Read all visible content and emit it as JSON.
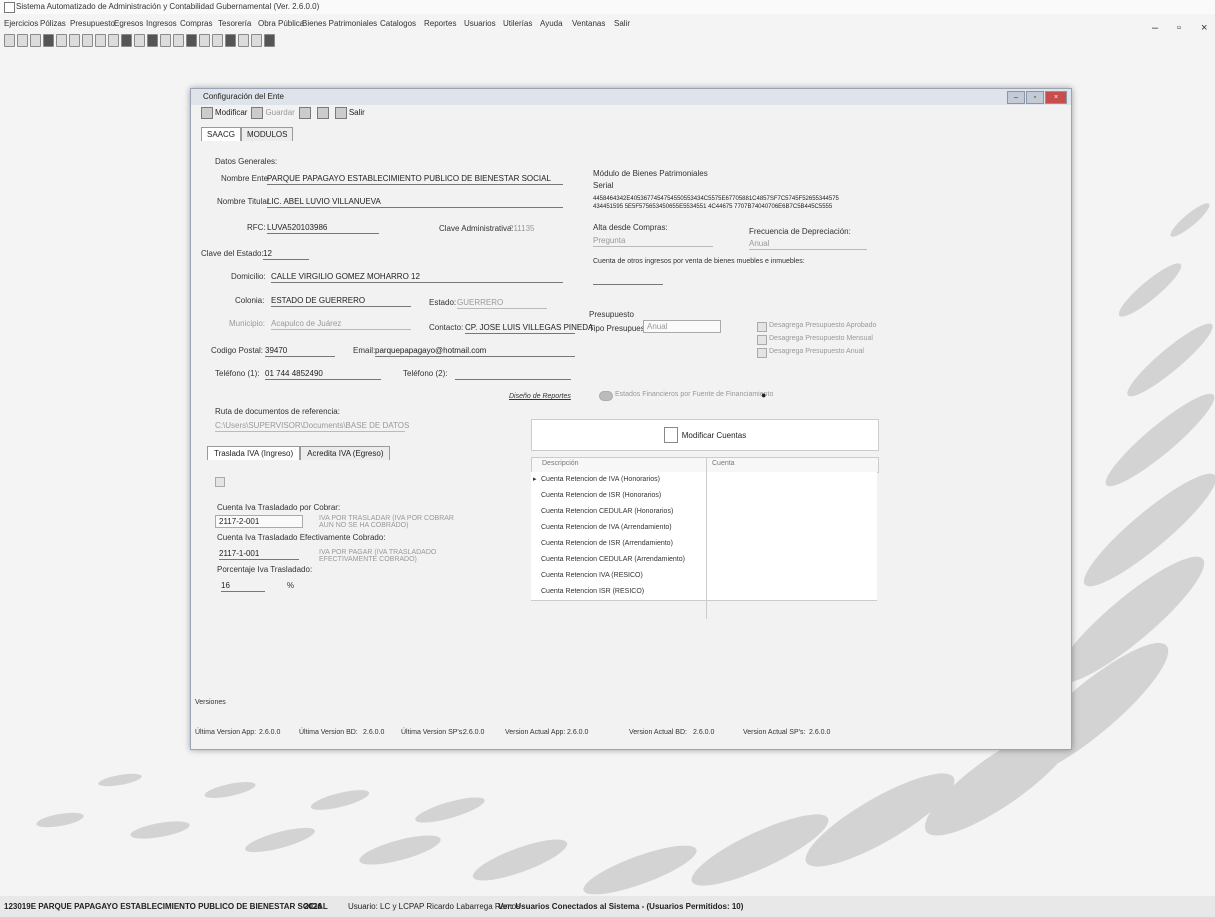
{
  "app": {
    "title": "Sistema Automatizado de Administración y Contabilidad Gubernamental (Ver. 2.6.0.0)"
  },
  "window_controls": {
    "minimize": "–",
    "restore": "▫",
    "close": "×"
  },
  "menu": [
    "Ejercicios",
    "Pólizas",
    "Presupuesto",
    "Egresos",
    "Ingresos",
    "Compras",
    "Tesorería",
    "Obra Pública",
    "Bienes Patrimoniales",
    "Catalogos",
    "Reportes",
    "Usuarios",
    "Utilerías",
    "Ayuda",
    "Ventanas",
    "Salir"
  ],
  "child": {
    "title": "Configuración del Ente",
    "toolbar": {
      "modify": "Modificar",
      "save": "Guardar",
      "exit": "Salir"
    },
    "tabs": [
      "SAACG",
      "MODULOS"
    ],
    "general": {
      "section": "Datos Generales:",
      "nombre_ente_label": "Nombre Ente",
      "nombre_ente": "PARQUE PAPAGAYO ESTABLECIMIENTO PUBLICO DE BIENESTAR SOCIAL",
      "titular_label": "Nombre Titular",
      "titular": "LIC. ABEL LUVIO VILLANUEVA",
      "rfc_label": "RFC:",
      "rfc": "LUVA520103986",
      "clave_adm_label": "Clave Administrativa:",
      "clave_adm": "211135",
      "clave_estado_label": "Clave del Estado:",
      "clave_estado": "12",
      "domicilio_label": "Domicilio:",
      "domicilio": "CALLE VIRGILIO GOMEZ MOHARRO 12",
      "colonia_label": "Colonia:",
      "colonia": "ESTADO DE GUERRERO",
      "estado_label": "Estado:",
      "estado": "GUERRERO",
      "municipio_label": "Municipio:",
      "municipio": "Acapulco de Juárez",
      "contacto_label": "Contacto:",
      "contacto": "CP. JOSE LUIS VILLEGAS PINEDA",
      "cp_label": "Codigo Postal:",
      "cp": "39470",
      "email_label": "Email:",
      "email": "parquepapagayo@hotmail.com",
      "tel1_label": "Teléfono (1):",
      "tel1": "01 744 4852490",
      "tel2_label": "Teléfono (2):",
      "tel2": "",
      "diseno_reportes": "Diseño de Reportes"
    },
    "bienes": {
      "section": "Módulo de Bienes Patrimoniales",
      "serial_label": "Serial",
      "serial_line1": "4458464342E4053677454754550553434C5575E67705881C4857SF7C5745F52655344575",
      "serial_line2": "434451595 5E5F575653450655E5534551 4C44675 7707B74040706E6B7C5B445C5555",
      "alta_label": "Alta desde Compras:",
      "alta_value": "Pregunta",
      "freq_label": "Frecuencia de Depreciación:",
      "freq_value": "Anual",
      "cuenta_label": "Cuenta de otros ingresos por venta de bienes muebles e inmuebles:"
    },
    "presupuesto": {
      "section": "Presupuesto",
      "tipo_label": "Tipo Presupuesto:",
      "tipo_value": "Anual",
      "chk1": "Desagrega Presupuesto Aprobado",
      "chk2": "Desagrega Presupuesto Mensual",
      "chk3": "Desagrega Presupuesto Anual",
      "estados": "Estados Financieros por Fuente de Financiamiento"
    },
    "ruta": {
      "label": "Ruta de documentos de referencia:",
      "value": "C:\\Users\\SUPERVISOR\\Documents\\BASE DE DATOS"
    },
    "iva": {
      "tab1": "Traslada IVA (Ingreso)",
      "tab2": "Acredita IVA (Egreso)",
      "cobrar_label": "Cuenta Iva Trasladado por Cobrar:",
      "cobrar": "2117-2-001",
      "cobrar_desc": "IVA POR TRASLADAR (IVA POR COBRAR AUN NO SE HA COBRADO)",
      "cobrado_label": "Cuenta Iva Trasladado Efectivamente Cobrado:",
      "cobrado": "2117-1-001",
      "cobrado_desc": "IVA POR PAGAR (IVA TRASLADADO EFECTIVAMENTE COBRADO)",
      "porcentaje_label": "Porcentaje Iva Trasladado:",
      "porcentaje": "16",
      "pct": "%"
    },
    "cuentas": {
      "button": "Modificar Cuentas",
      "headers": [
        "Descripción",
        "Cuenta"
      ],
      "rows": [
        "Cuenta Retencion de IVA (Honorarios)",
        "Cuenta Retencion de ISR (Honorarios)",
        "Cuenta Retencion CEDULAR (Honorarios)",
        "Cuenta Retencion de IVA (Arrendamiento)",
        "Cuenta Retencion de ISR (Arrendamiento)",
        "Cuenta Retencion CEDULAR (Arrendamiento)",
        "Cuenta Retencion IVA (RESICO)",
        "Cuenta Retencion ISR (RESICO)"
      ]
    },
    "versiones": {
      "label": "Versiones",
      "app_label": "Última Version App:",
      "app": "2.6.0.0",
      "bd_label": "Última Version BD:",
      "bd": "2.6.0.0",
      "sp_label": "Última Version SP's:",
      "sp": "2.6.0.0",
      "act_app_label": "Version Actual App:",
      "act_app": "2.6.0.0",
      "act_bd_label": "Version Actual BD:",
      "act_bd": "2.6.0.0",
      "act_sp_label": "Version Actual SP's:",
      "act_sp": "2.6.0.0"
    }
  },
  "status": {
    "ente": "123019E PARQUE PAPAGAYO ESTABLECIMIENTO PUBLICO DE BIENESTAR SOCIAL",
    "year": "2026",
    "usuario": "Usuario: LC y LCPAP Ricardo Labarrega Ramos",
    "conectados": "Ver: Usuarios Conectados al Sistema - (Usuarios Permitidos: 10)"
  }
}
